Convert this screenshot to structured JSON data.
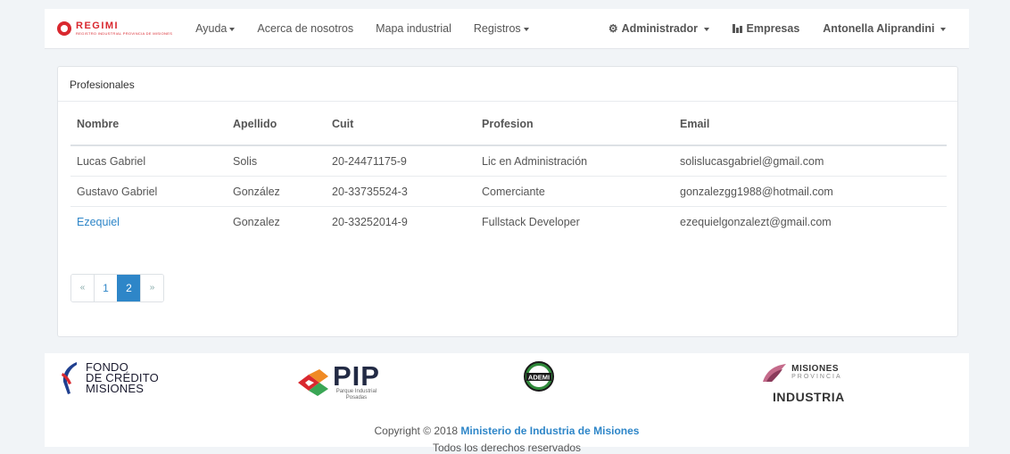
{
  "brand": {
    "name": "REGIMI",
    "subtitle": "REGISTRO INDUSTRIAL PROVINCIA DE MISIONES"
  },
  "nav": {
    "left": [
      "Ayuda",
      "Acerca de nosotros",
      "Mapa industrial",
      "Registros"
    ],
    "admin": "Administrador",
    "companies": "Empresas",
    "user": "Antonella Aliprandini"
  },
  "panel": {
    "title": "Profesionales",
    "columns": [
      "Nombre",
      "Apellido",
      "Cuit",
      "Profesion",
      "Email"
    ],
    "rows": [
      [
        "Lucas Gabriel",
        "Solis",
        "20-24471175-9",
        "Lic en Administración",
        "solislucasgabriel@gmail.com"
      ],
      [
        "Gustavo Gabriel",
        "González",
        "20-33735524-3",
        "Comerciante",
        "gonzalezgg1988@hotmail.com"
      ],
      [
        "Ezequiel",
        "Gonzalez",
        "20-33252014-9",
        "Fullstack Developer",
        "ezequielgonzalezt@gmail.com"
      ]
    ]
  },
  "pagination": {
    "prev": "«",
    "pages": [
      "1",
      "2"
    ],
    "next": "»",
    "active_page": "2"
  },
  "footer": {
    "fondo": [
      "FONDO",
      "DE CRÉDITO",
      "MISIONES"
    ],
    "pip": {
      "name": "PIP",
      "line1": "Parque Industrial",
      "line2": "Posadas"
    },
    "ademi": "ADEMI",
    "misiones": {
      "name": "MISIONES",
      "sub": "PROVINCIA",
      "industria": "INDUSTRIA"
    },
    "copyright_prefix": "Copyright © 2018",
    "copyright_link": "Ministerio de Industria de Misiones",
    "rights": "Todos los derechos reservados"
  },
  "colors": {
    "accent": "#2e86c8",
    "brand_red": "#d9282f",
    "page_bg": "#f1f4f7"
  }
}
